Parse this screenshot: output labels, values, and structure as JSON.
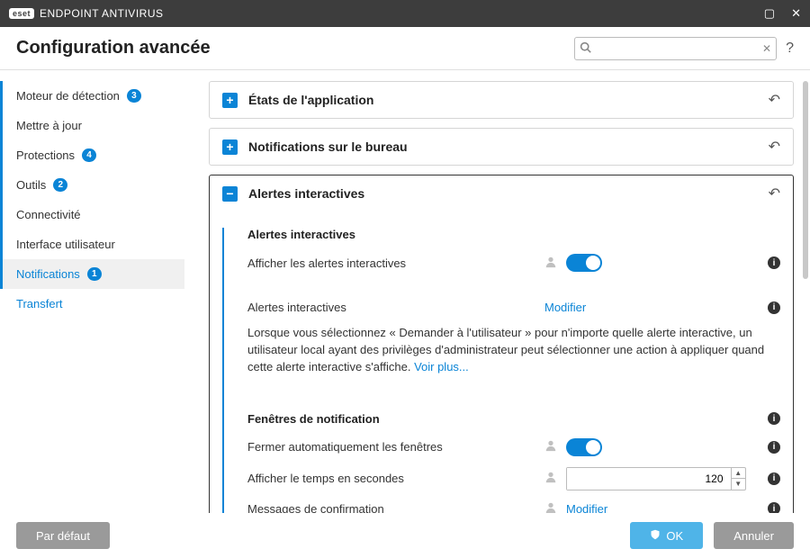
{
  "titlebar": {
    "brand_pill": "eset",
    "product": "ENDPOINT ANTIVIRUS"
  },
  "header": {
    "title": "Configuration avancée",
    "search_placeholder": ""
  },
  "sidebar": {
    "items": [
      {
        "label": "Moteur de détection",
        "badge": "3"
      },
      {
        "label": "Mettre à jour"
      },
      {
        "label": "Protections",
        "badge": "4"
      },
      {
        "label": "Outils",
        "badge": "2"
      },
      {
        "label": "Connectivité"
      },
      {
        "label": "Interface utilisateur"
      },
      {
        "label": "Notifications",
        "badge": "1"
      },
      {
        "label": "Transfert"
      }
    ]
  },
  "panels": {
    "app_states": {
      "title": "États de l'application"
    },
    "desktop_notifs": {
      "title": "Notifications sur le bureau"
    },
    "interactive_alerts": {
      "title": "Alertes interactives",
      "section1_heading": "Alertes interactives",
      "row_show_alerts": "Afficher les alertes interactives",
      "row_alerts_link_label": "Alertes interactives",
      "row_alerts_link_action": "Modifier",
      "description": "Lorsque vous sélectionnez « Demander à l'utilisateur » pour n'importe quelle alerte interactive, un utilisateur local ayant des privilèges d'administrateur peut sélectionner une action à appliquer quand cette alerte interactive s'affiche. ",
      "description_more": "Voir plus...",
      "section2_heading": "Fenêtres de notification",
      "row_autoclose": "Fermer automatiquement les fenêtres",
      "row_time_seconds": "Afficher le temps en secondes",
      "row_time_value": "120",
      "row_confirm_label": "Messages de confirmation",
      "row_confirm_action": "Modifier"
    }
  },
  "footer": {
    "default": "Par défaut",
    "ok": "OK",
    "cancel": "Annuler"
  }
}
